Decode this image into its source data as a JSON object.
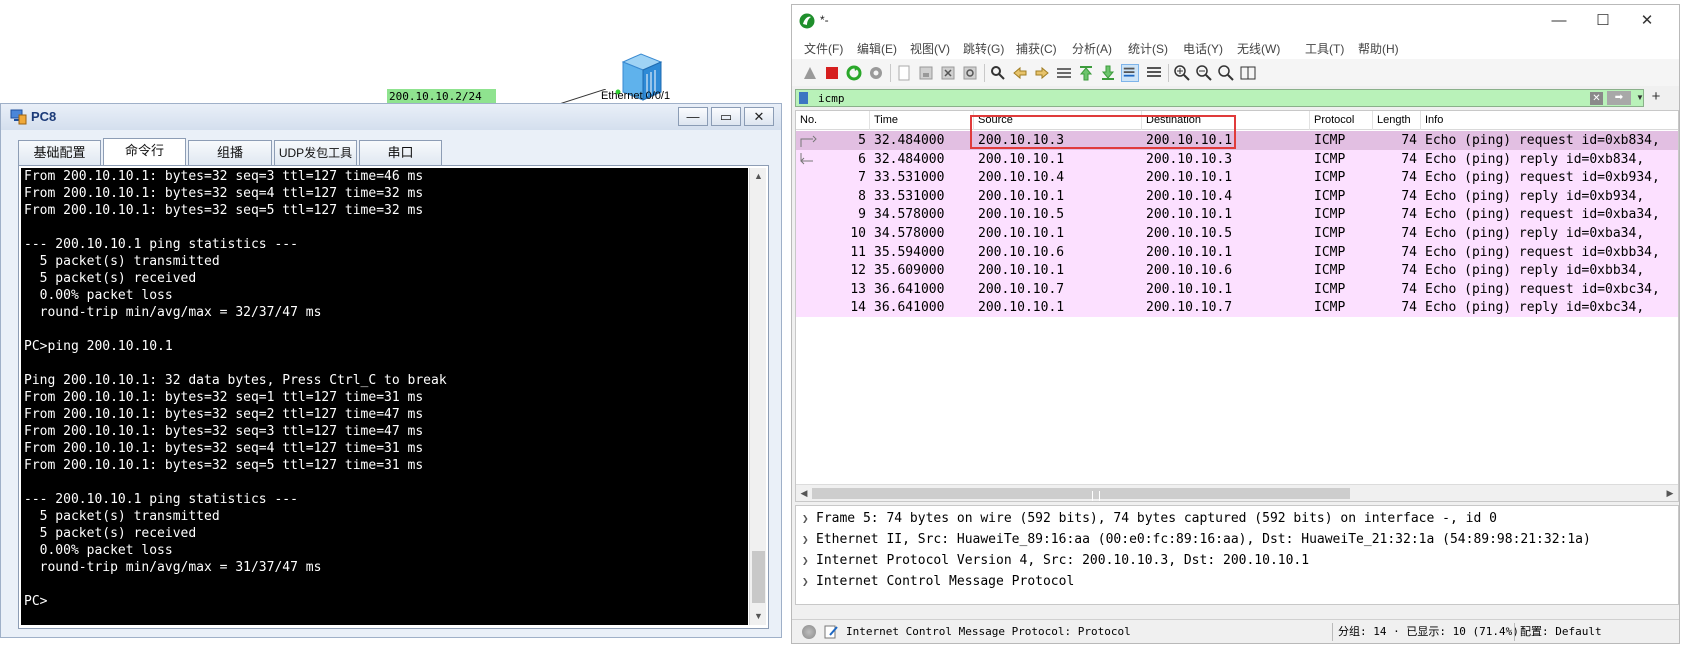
{
  "topology": {
    "ip_label": "200.10.10.2/24",
    "port_label": "Ethernet 0/0/1"
  },
  "pc8": {
    "title": "PC8",
    "tabs": [
      "基础配置",
      "命令行",
      "组播",
      "UDP发包工具",
      "串口"
    ],
    "active_tab": "命令行",
    "terminal_lines": [
      "From 200.10.10.1: bytes=32 seq=3 ttl=127 time=46 ms",
      "From 200.10.10.1: bytes=32 seq=4 ttl=127 time=32 ms",
      "From 200.10.10.1: bytes=32 seq=5 ttl=127 time=32 ms",
      "",
      "--- 200.10.10.1 ping statistics ---",
      "  5 packet(s) transmitted",
      "  5 packet(s) received",
      "  0.00% packet loss",
      "  round-trip min/avg/max = 32/37/47 ms",
      "",
      "PC>ping 200.10.10.1",
      "",
      "Ping 200.10.10.1: 32 data bytes, Press Ctrl_C to break",
      "From 200.10.10.1: bytes=32 seq=1 ttl=127 time=31 ms",
      "From 200.10.10.1: bytes=32 seq=2 ttl=127 time=47 ms",
      "From 200.10.10.1: bytes=32 seq=3 ttl=127 time=47 ms",
      "From 200.10.10.1: bytes=32 seq=4 ttl=127 time=31 ms",
      "From 200.10.10.1: bytes=32 seq=5 ttl=127 time=31 ms",
      "",
      "--- 200.10.10.1 ping statistics ---",
      "  5 packet(s) transmitted",
      "  5 packet(s) received",
      "  0.00% packet loss",
      "  round-trip min/avg/max = 31/37/47 ms",
      "",
      "PC>"
    ]
  },
  "wireshark": {
    "title": "*-",
    "menu": [
      "文件(F)",
      "编辑(E)",
      "视图(V)",
      "跳转(G)",
      "捕获(C)",
      "分析(A)",
      "统计(S)",
      "电话(Y)",
      "无线(W)",
      "工具(T)",
      "帮助(H)"
    ],
    "toolbar_icons": [
      "shark-fin-icon",
      "stop-icon",
      "restart-icon",
      "options-gear-icon",
      "open-file-icon",
      "save-file-icon",
      "close-file-icon",
      "reload-icon",
      "find-icon",
      "go-back-icon",
      "go-forward-icon",
      "go-to-packet-icon",
      "go-first-icon",
      "go-last-icon",
      "autoscroll-icon",
      "colorize-icon",
      "zoom-in-icon",
      "zoom-out-icon",
      "zoom-normal-icon",
      "resize-columns-icon"
    ],
    "filter_value": "icmp",
    "columns": [
      "No.",
      "Time",
      "Source",
      "Destination",
      "Protocol",
      "Length",
      "Info"
    ],
    "packets": [
      {
        "no": "5",
        "time": "32.484000",
        "src": "200.10.10.3",
        "dst": "200.10.10.1",
        "proto": "ICMP",
        "len": "74",
        "info": "Echo (ping) request  id=0xb834,"
      },
      {
        "no": "6",
        "time": "32.484000",
        "src": "200.10.10.1",
        "dst": "200.10.10.3",
        "proto": "ICMP",
        "len": "74",
        "info": "Echo (ping) reply    id=0xb834,"
      },
      {
        "no": "7",
        "time": "33.531000",
        "src": "200.10.10.4",
        "dst": "200.10.10.1",
        "proto": "ICMP",
        "len": "74",
        "info": "Echo (ping) request  id=0xb934,"
      },
      {
        "no": "8",
        "time": "33.531000",
        "src": "200.10.10.1",
        "dst": "200.10.10.4",
        "proto": "ICMP",
        "len": "74",
        "info": "Echo (ping) reply    id=0xb934,"
      },
      {
        "no": "9",
        "time": "34.578000",
        "src": "200.10.10.5",
        "dst": "200.10.10.1",
        "proto": "ICMP",
        "len": "74",
        "info": "Echo (ping) request  id=0xba34,"
      },
      {
        "no": "10",
        "time": "34.578000",
        "src": "200.10.10.1",
        "dst": "200.10.10.5",
        "proto": "ICMP",
        "len": "74",
        "info": "Echo (ping) reply    id=0xba34,"
      },
      {
        "no": "11",
        "time": "35.594000",
        "src": "200.10.10.6",
        "dst": "200.10.10.1",
        "proto": "ICMP",
        "len": "74",
        "info": "Echo (ping) request  id=0xbb34,"
      },
      {
        "no": "12",
        "time": "35.609000",
        "src": "200.10.10.1",
        "dst": "200.10.10.6",
        "proto": "ICMP",
        "len": "74",
        "info": "Echo (ping) reply    id=0xbb34,"
      },
      {
        "no": "13",
        "time": "36.641000",
        "src": "200.10.10.7",
        "dst": "200.10.10.1",
        "proto": "ICMP",
        "len": "74",
        "info": "Echo (ping) request  id=0xbc34,"
      },
      {
        "no": "14",
        "time": "36.641000",
        "src": "200.10.10.1",
        "dst": "200.10.10.7",
        "proto": "ICMP",
        "len": "74",
        "info": "Echo (ping) reply    id=0xbc34,"
      }
    ],
    "selected_packet": "5",
    "details": [
      "Frame 5: 74 bytes on wire (592 bits), 74 bytes captured (592 bits) on interface -, id 0",
      "Ethernet II, Src: HuaweiTe_89:16:aa (00:e0:fc:89:16:aa), Dst: HuaweiTe_21:32:1a (54:89:98:21:32:1a)",
      "Internet Protocol Version 4, Src: 200.10.10.3, Dst: 200.10.10.1",
      "Internet Control Message Protocol"
    ],
    "status": {
      "field": "Internet Control Message Protocol: Protocol",
      "packets": "分组: 14 · 已显示: 10 (71.4%)",
      "profile": "配置: Default"
    },
    "colors": {
      "row_bg": "#fce0ff",
      "row_selected": "#e2bfe2",
      "filter_bg": "#b9f2b9",
      "highlight_box": "#e03b3b"
    }
  }
}
